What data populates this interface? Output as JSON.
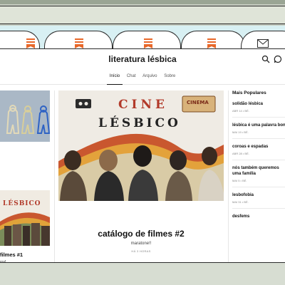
{
  "browser": {
    "tabs": [
      {
        "icon": "substack-icon"
      },
      {
        "icon": "substack-icon"
      },
      {
        "icon": "substack-icon"
      },
      {
        "icon": "mail-icon"
      }
    ]
  },
  "publication": {
    "title": "literatura lésbica"
  },
  "nav": {
    "items": [
      "Início",
      "Chat",
      "Arquivo",
      "Sobre"
    ],
    "active": "Início"
  },
  "left_column": {
    "post_title": "filmes #1",
    "post_subtitle": "ros]",
    "collage_text": "LÉSBICO"
  },
  "featured": {
    "image_words": [
      "CINE",
      "LÉSBICO"
    ],
    "ticket_text": "CINEMA",
    "title": "catálogo de filmes #2",
    "subtitle": "maratone!!",
    "time": "HÁ 3 HORAS"
  },
  "sidebar": {
    "heading": "Mais Populares",
    "items": [
      {
        "title": "solidão lésbica",
        "meta": "ABR 14 • BÉ."
      },
      {
        "title": "lésbica é uma palavra bonita",
        "meta": "MAI 19 • BÉ."
      },
      {
        "title": "coroas e espadas",
        "meta": "ABR 28 • BÉ."
      },
      {
        "title": "nós também queremos uma família",
        "meta": "MAI 5 • BÉ."
      },
      {
        "title": "lesbofobia",
        "meta": "MAI 31 • BÉ."
      },
      {
        "title": "desfems",
        "meta": ""
      }
    ]
  },
  "colors": {
    "tabbar_bg": "#d8f0f3",
    "accent_orange": "#e8682a",
    "frame_green": "#c9cfc4"
  }
}
